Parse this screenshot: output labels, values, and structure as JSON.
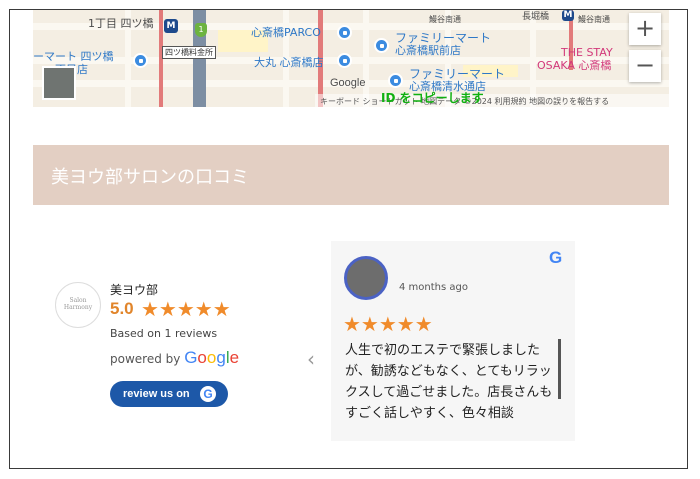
{
  "map": {
    "labels": {
      "chome_yotsubashi": "1丁目 四ツ橋",
      "mart_yotsubashi": "ーマート 四ツ橋",
      "chome_store": "一丁目店",
      "yotsubashi_box": "四ツ橋料金所",
      "parco": "心斎橋PARCO",
      "daimaru": "大丸 心斎橋店",
      "famima1_line1": "ファミリーマート",
      "famima1_line2": "心斎橋駅前店",
      "famima2_line1": "ファミリーマート",
      "famima2_line2": "心斎橋清水通店",
      "top_left_street": "鰻谷南通",
      "top_right_station": "長堀橋",
      "top_right_street": "鰻谷南通",
      "stay_line1": "THE STAY",
      "stay_line2": "OSAKA 心斎橋",
      "google": "Google",
      "footer": "キーボード ショートカット 地図データ ©2024  利用規約  地図の誤りを報告する",
      "overlay": "ID をコピーします",
      "metro_icon_text": "M",
      "green_badge_text": "1"
    },
    "zoom_in": "+",
    "zoom_out": "−"
  },
  "section": {
    "title": "美ヨウ部サロンの口コミ"
  },
  "business": {
    "logo_text": "Salon Harmony",
    "name": "美ヨウ部",
    "rating": "5.0",
    "stars": "★★★★★",
    "based_on": "Based on 1 reviews",
    "powered_by": "powered by",
    "google_word": "Google",
    "review_button": "review us on",
    "review_button_g": "G"
  },
  "carousel": {
    "prev": "‹"
  },
  "review": {
    "google_mark": "G",
    "date": "4 months ago",
    "stars": "★★★★★",
    "text": "人生で初のエステで緊張しましたが、勧誘などもなく、とてもリラックスして過ごせました。店長さんもすごく話しやすく、色々相談"
  },
  "colors": {
    "header_bg": "#e3cfc3",
    "star": "#f08b2b",
    "button": "#1d58a8"
  }
}
